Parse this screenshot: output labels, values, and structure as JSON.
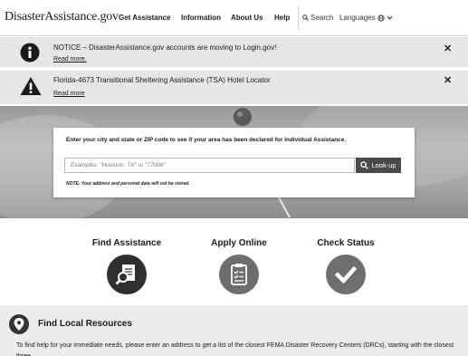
{
  "header": {
    "logo": "DisasterAssistance.gov",
    "nav": [
      "Get Assistance",
      "Information",
      "About Us",
      "Help"
    ],
    "search_label": "Search",
    "languages_label": "Languages"
  },
  "notices": [
    {
      "icon": "info-icon",
      "text": "NOTICE – DisasterAssistance.gov accounts are moving to Login.gov!",
      "link": "Read more."
    },
    {
      "icon": "warning-icon",
      "text": "Florida-4673 Transitional Sheltering Assistance (TSA) Hotel Locator",
      "link": "Read more"
    }
  ],
  "hero": {
    "prompt": "Enter your city and state or ZIP code to see if your area has been declared for Individual Assistance.",
    "placeholder": "Examples: \"Houston, TX\" or \"77006\"",
    "button_label": "Look-up",
    "note": "NOTE: Your address and personal data will not be stored."
  },
  "actions": [
    {
      "label": "Find Assistance",
      "icon": "search-document-icon"
    },
    {
      "label": "Apply Online",
      "icon": "clipboard-icon"
    },
    {
      "label": "Check Status",
      "icon": "checkmark-icon"
    }
  ],
  "local": {
    "title": "Find Local Resources",
    "description": "To find help for your immediate needs, please enter an address to get a list of the closest FEMA Disaster Recovery Centers (DRCs), starting with the closest three."
  },
  "colors": {
    "dark_circle": "#2f2f2f",
    "mid_circle": "#6e6e6e",
    "button": "#4a4a4a",
    "notice_bg": "#e6e6e6"
  }
}
